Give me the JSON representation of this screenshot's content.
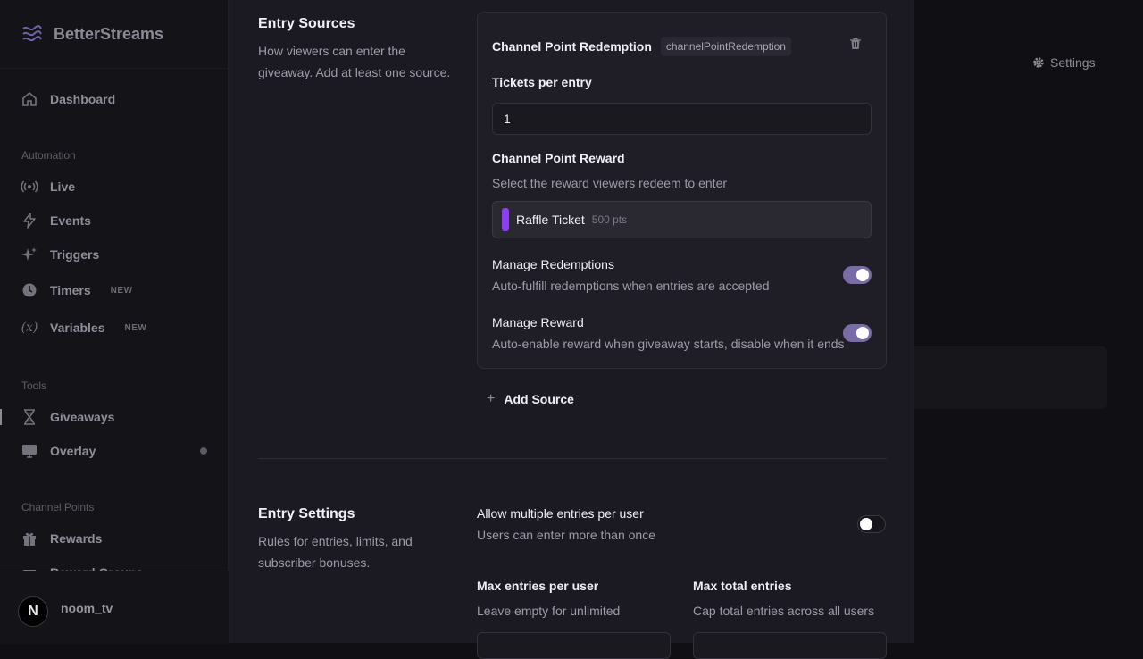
{
  "app": {
    "name": "BetterStreams"
  },
  "sidebar": {
    "dashboard": "Dashboard",
    "sections": {
      "automation": "Automation",
      "tools": "Tools",
      "channel_points": "Channel Points"
    },
    "items": [
      {
        "label": "Live"
      },
      {
        "label": "Events"
      },
      {
        "label": "Triggers"
      },
      {
        "label": "Timers",
        "badge": "NEW"
      },
      {
        "label": "Variables",
        "badge": "NEW"
      },
      {
        "label": "Giveaways"
      },
      {
        "label": "Overlay"
      },
      {
        "label": "Rewards"
      },
      {
        "label": "Reward Groups"
      }
    ],
    "user": {
      "initial": "N",
      "name": "noom_tv"
    }
  },
  "background": {
    "settings_label": "Settings"
  },
  "entry_sources": {
    "title": "Entry Sources",
    "description": "How viewers can enter the giveaway. Add at least one source.",
    "source": {
      "title": "Channel Point Redemption",
      "type_chip": "channelPointRedemption",
      "tickets_label": "Tickets per entry",
      "tickets_value": "1",
      "reward_label": "Channel Point Reward",
      "reward_help": "Select the reward viewers redeem to enter",
      "reward_name": "Raffle Ticket",
      "reward_cost": "500 pts",
      "reward_color": "#8b3ff0",
      "manage_redemptions_label": "Manage Redemptions",
      "manage_redemptions_desc": "Auto-fulfill redemptions when entries are accepted",
      "manage_redemptions_on": true,
      "manage_reward_label": "Manage Reward",
      "manage_reward_desc": "Auto-enable reward when giveaway starts, disable when it ends",
      "manage_reward_on": true
    },
    "add_source_label": "Add Source"
  },
  "entry_settings": {
    "title": "Entry Settings",
    "description": "Rules for entries, limits, and subscriber bonuses.",
    "allow_multiple_label": "Allow multiple entries per user",
    "allow_multiple_desc": "Users can enter more than once",
    "allow_multiple_on": false,
    "max_per_user_label": "Max entries per user",
    "max_per_user_help": "Leave empty for unlimited",
    "max_total_label": "Max total entries",
    "max_total_help": "Cap total entries across all users"
  },
  "colors": {
    "accent_toggle": "#7a6ca6",
    "panel": "#1b1a22"
  }
}
